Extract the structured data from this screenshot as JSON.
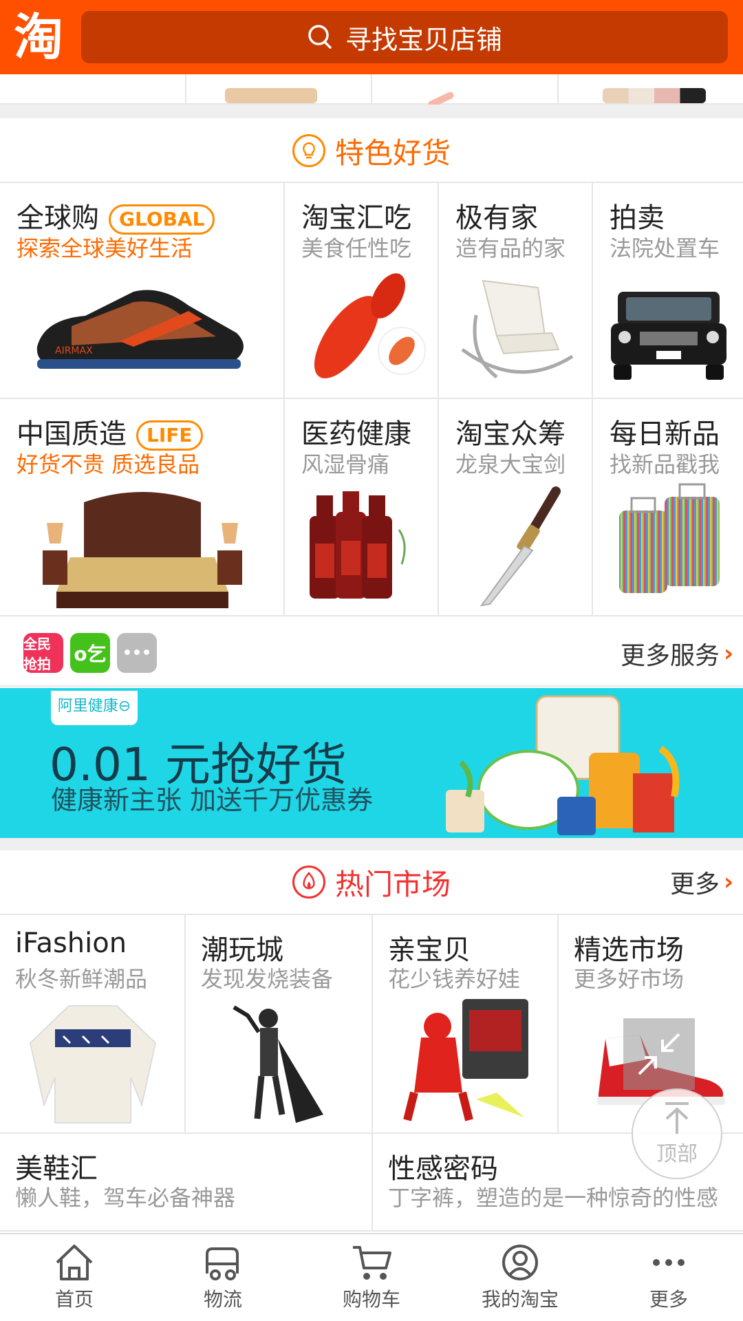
{
  "header": {
    "logo_text": "淘",
    "search_placeholder": "寻找宝贝店铺"
  },
  "featured": {
    "title": "特色好货",
    "items": [
      {
        "title": "全球购",
        "badge": "GLOBAL",
        "subtitle": "探索全球美好生活",
        "image": "sneaker"
      },
      {
        "title": "淘宝汇吃",
        "subtitle": "美食任性吃",
        "image": "lobster"
      },
      {
        "title": "极有家",
        "subtitle": "造有品的家",
        "image": "chair"
      },
      {
        "title": "拍卖",
        "subtitle": "法院处置车",
        "image": "suv"
      },
      {
        "title": "中国质造",
        "badge": "LIFE",
        "subtitle": "好货不贵 质选良品",
        "image": "bed"
      },
      {
        "title": "医药健康",
        "subtitle": "风湿骨痛",
        "image": "wine-bottles"
      },
      {
        "title": "淘宝众筹",
        "subtitle": "龙泉大宝剑",
        "image": "sword"
      },
      {
        "title": "每日新品",
        "subtitle": "找新品戳我",
        "image": "suitcases"
      }
    ]
  },
  "services": {
    "icons": [
      {
        "name": "quanmin-qiangou-icon",
        "text": "全民抢拍",
        "color": "#f0325a"
      },
      {
        "name": "koubei-icon",
        "text": "o乞",
        "color": "#44c11a"
      },
      {
        "name": "more-dots-icon",
        "text": "•••",
        "color": "#bbbbbb"
      }
    ],
    "more_label": "更多服务"
  },
  "banner": {
    "brand": "阿里健康⊖",
    "headline": "0.01 元抢好货",
    "subline": "健康新主张  加送千万优惠券"
  },
  "hot_market": {
    "title": "热门市场",
    "more_label": "更多",
    "items": [
      {
        "title": "iFashion",
        "subtitle": "秋冬新鲜潮品",
        "image": "sweater"
      },
      {
        "title": "潮玩城",
        "subtitle": "发现发烧装备",
        "image": "figure"
      },
      {
        "title": "亲宝贝",
        "subtitle": "花少钱养好娃",
        "image": "robot-toy"
      },
      {
        "title": "精选市场",
        "subtitle": "更多好市场",
        "image": "red-shoe"
      },
      {
        "title": "美鞋汇",
        "subtitle": "懒人鞋，驾车必备神器"
      },
      {
        "title": "性感密码",
        "subtitle": "丁字裤，塑造的是一种惊奇的性感"
      }
    ]
  },
  "floating": {
    "top_label": "顶部"
  },
  "tabbar": {
    "tabs": [
      {
        "label": "首页",
        "icon": "home-icon"
      },
      {
        "label": "物流",
        "icon": "truck-icon"
      },
      {
        "label": "购物车",
        "icon": "cart-icon"
      },
      {
        "label": "我的淘宝",
        "icon": "profile-icon"
      },
      {
        "label": "更多",
        "icon": "more-icon"
      }
    ]
  },
  "colors": {
    "brand_orange": "#ff5000",
    "hot_red": "#f23030",
    "banner_cyan": "#1ed6e6"
  }
}
